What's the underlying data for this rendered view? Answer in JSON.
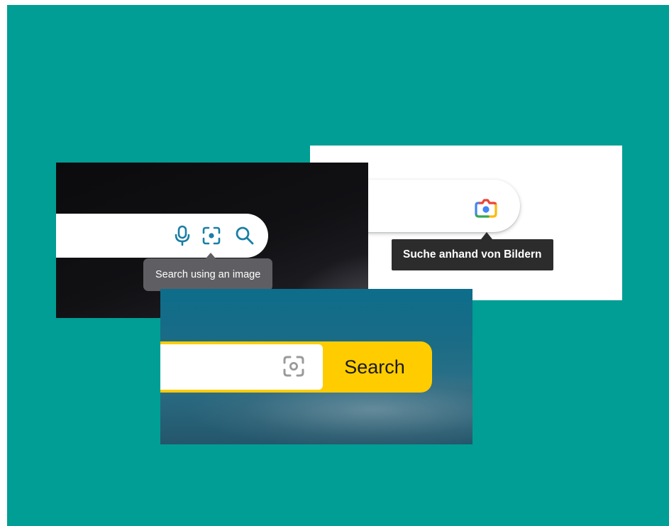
{
  "colors": {
    "background": "#009e94",
    "google_tooltip_bg": "#2c2c2c",
    "bing_icon": "#1a7fa3",
    "bing_tooltip_bg": "#5f5f63",
    "yandex_yellow": "#ffcc00"
  },
  "google_panel": {
    "lens_icon": "google-lens-camera-icon",
    "tooltip": "Suche anhand von Bildern"
  },
  "bing_panel": {
    "icons": [
      "microphone-icon",
      "visual-search-icon",
      "search-icon"
    ],
    "tooltip": "Search using an image"
  },
  "yandex_panel": {
    "camera_icon": "camera-search-icon",
    "search_button": "Search"
  }
}
